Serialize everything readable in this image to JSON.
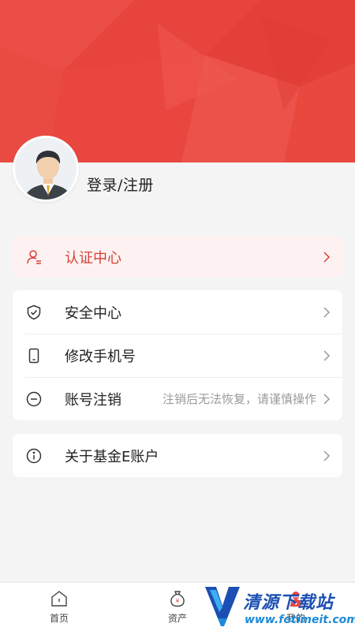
{
  "profile": {
    "login_label": "登录/注册"
  },
  "auth": {
    "label": "认证中心",
    "icon": "user-auth-icon",
    "accent": "#d6403a"
  },
  "menu": [
    {
      "label": "安全中心",
      "icon": "shield-check-icon"
    },
    {
      "label": "修改手机号",
      "icon": "phone-icon"
    },
    {
      "label": "账号注销",
      "icon": "minus-circle-icon",
      "hint": "注销后无法恢复，请谨慎操作"
    }
  ],
  "about": {
    "label": "关于基金E账户",
    "icon": "info-circle-icon"
  },
  "tabbar": {
    "items": [
      {
        "label": "首页",
        "icon": "home-icon"
      },
      {
        "label": "资产",
        "icon": "money-bag-icon"
      },
      {
        "label": "我的",
        "icon": "user-icon"
      }
    ]
  },
  "watermark": {
    "title": "清源下载站",
    "url": "www.fotimeit.com"
  },
  "colors": {
    "brand_red": "#e8463f",
    "watermark_blue": "#1b4fb3"
  }
}
